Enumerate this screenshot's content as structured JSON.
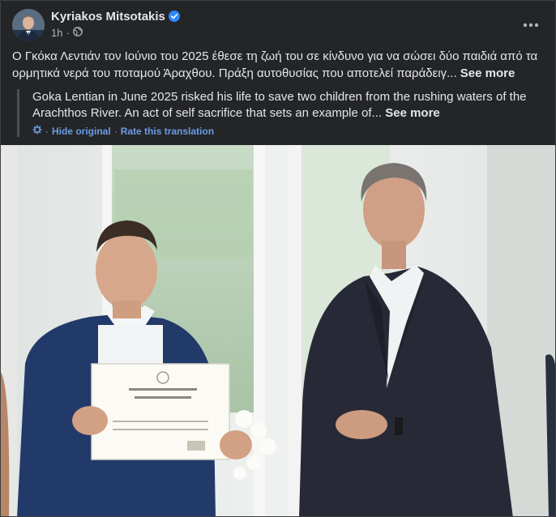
{
  "post": {
    "author": "Kyriakos Mitsotakis",
    "time": "1h",
    "separator": "·",
    "original_text": "Ο Γκόκα Λεντιάν τον Ιούνιο του 2025 έθεσε τη ζωή του σε κίνδυνο για να σώσει δύο παιδιά από τα ορμητικά νερά του ποταμού Άραχθου. Πράξη αυτοθυσίας που αποτελεί παράδειγ...",
    "original_see_more": "See more",
    "translated_text": "Goka Lentian in June 2025 risked his life to save two children from the rushing waters of the Arachthos River. An act of self sacrifice that sets an example of...",
    "translated_see_more": "See more",
    "hide_original": "Hide original",
    "rate_translation": "Rate this translation",
    "link_separator": "·"
  },
  "colors": {
    "background": "#242526",
    "text_primary": "#e4e6eb",
    "text_secondary": "#b0b3b8",
    "link": "#6b9ce8",
    "verified": "#2d88ff"
  },
  "icons": {
    "verified": "verified-badge-icon",
    "audience": "globe-icon",
    "more": "more-options-icon",
    "translate": "translate-gear-icon"
  }
}
